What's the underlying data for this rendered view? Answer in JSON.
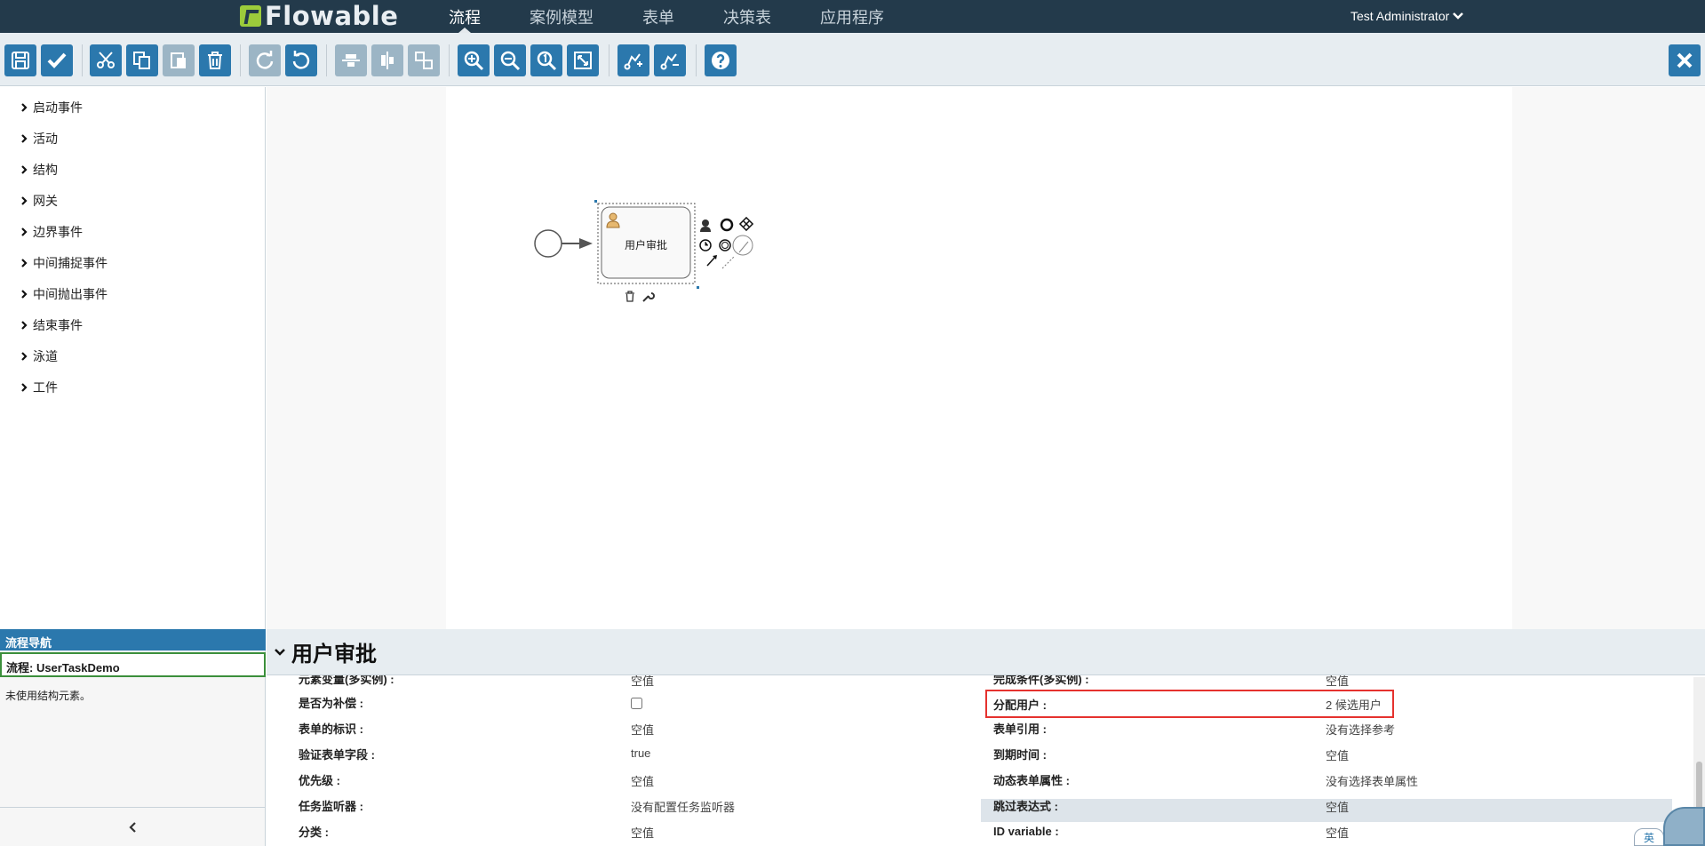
{
  "app": {
    "logo_text": "Flowable",
    "nav": [
      "流程",
      "案例模型",
      "表单",
      "决策表",
      "应用程序"
    ],
    "active_nav": "流程",
    "user": "Test Administrator"
  },
  "toolbar": {
    "buttons": [
      {
        "name": "save",
        "icon": "save-icon",
        "enabled": true
      },
      {
        "name": "validate",
        "icon": "check-icon",
        "enabled": true
      },
      {
        "name": "cut",
        "icon": "scissors-icon",
        "enabled": true
      },
      {
        "name": "copy",
        "icon": "copy-icon",
        "enabled": true
      },
      {
        "name": "paste",
        "icon": "paste-icon",
        "enabled": false
      },
      {
        "name": "delete",
        "icon": "trash-icon",
        "enabled": true
      },
      {
        "name": "redo",
        "icon": "redo-icon",
        "enabled": false
      },
      {
        "name": "undo",
        "icon": "undo-icon",
        "enabled": true
      },
      {
        "name": "align-horizontal",
        "icon": "align-horizontal-icon",
        "enabled": false
      },
      {
        "name": "align-vertical",
        "icon": "align-vertical-icon",
        "enabled": false
      },
      {
        "name": "same-size",
        "icon": "same-size-icon",
        "enabled": false
      },
      {
        "name": "zoom-in",
        "icon": "zoom-in-icon",
        "enabled": true
      },
      {
        "name": "zoom-out",
        "icon": "zoom-out-icon",
        "enabled": true
      },
      {
        "name": "zoom-actual",
        "icon": "zoom-actual-icon",
        "enabled": true
      },
      {
        "name": "zoom-fit",
        "icon": "zoom-fit-icon",
        "enabled": true
      },
      {
        "name": "add-bendpoint",
        "icon": "add-bendpoint-icon",
        "enabled": true
      },
      {
        "name": "remove-bendpoint",
        "icon": "remove-bendpoint-icon",
        "enabled": true
      },
      {
        "name": "help",
        "icon": "help-icon",
        "enabled": true
      },
      {
        "name": "close",
        "icon": "close-icon",
        "enabled": true
      }
    ]
  },
  "palette": {
    "groups": [
      "启动事件",
      "活动",
      "结构",
      "网关",
      "边界事件",
      "中间捕捉事件",
      "中间抛出事件",
      "结束事件",
      "泳道",
      "工件"
    ]
  },
  "canvas": {
    "task_label": "用户审批"
  },
  "navigator": {
    "title": "流程导航",
    "process": "流程: UserTaskDemo",
    "info": "未使用结构元素。"
  },
  "properties": {
    "title": "用户审批",
    "left": [
      {
        "label": "元素变量(多实例) :",
        "value": "空值"
      },
      {
        "label": "是否为补偿 :",
        "value": "",
        "checkbox": true
      },
      {
        "label": "表单的标识 :",
        "value": "空值"
      },
      {
        "label": "验证表单字段 :",
        "value": "true"
      },
      {
        "label": "优先级 :",
        "value": "空值"
      },
      {
        "label": "任务监听器 :",
        "value": "没有配置任务监听器"
      },
      {
        "label": "分类 :",
        "value": "空值"
      }
    ],
    "right": [
      {
        "label": "完成条件(多实例) :",
        "value": "空值"
      },
      {
        "label": "分配用户 :",
        "value": "2 候选用户"
      },
      {
        "label": "表单引用 :",
        "value": "没有选择参考"
      },
      {
        "label": "到期时间 :",
        "value": "空值"
      },
      {
        "label": "动态表单属性 :",
        "value": "没有选择表单属性"
      },
      {
        "label": "跳过表达式 :",
        "value": "空值"
      },
      {
        "label": "ID variable :",
        "value": "空值"
      }
    ]
  },
  "ime_badge": "英"
}
